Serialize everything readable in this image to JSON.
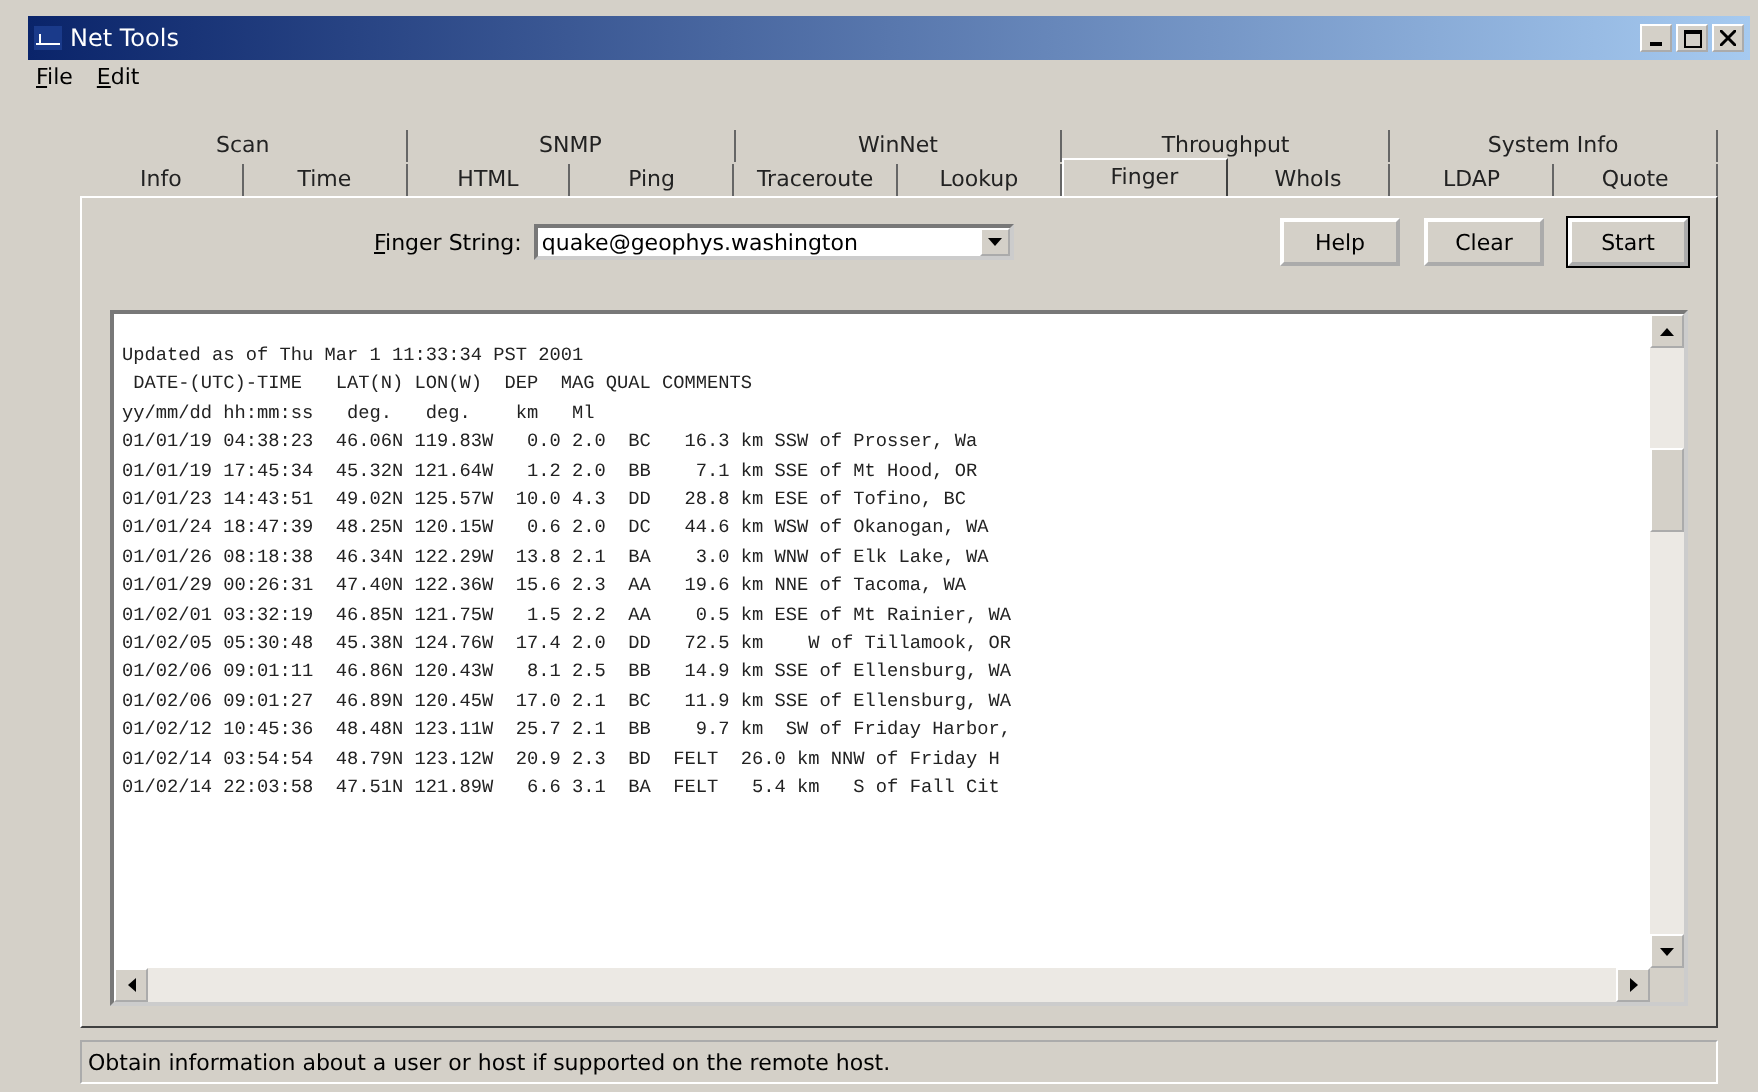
{
  "window": {
    "title": "Net Tools"
  },
  "menu": [
    "File",
    "Edit"
  ],
  "tab_rows": [
    [
      {
        "label": "Scan",
        "selected": false
      },
      {
        "label": "SNMP",
        "selected": false
      },
      {
        "label": "WinNet",
        "selected": false
      },
      {
        "label": "Throughput",
        "selected": false
      },
      {
        "label": "System Info",
        "selected": false
      }
    ],
    [
      {
        "label": "Info",
        "selected": false
      },
      {
        "label": "Time",
        "selected": false
      },
      {
        "label": "HTML",
        "selected": false
      },
      {
        "label": "Ping",
        "selected": false
      },
      {
        "label": "Traceroute",
        "selected": false
      },
      {
        "label": "Lookup",
        "selected": false
      },
      {
        "label": "Finger",
        "selected": true
      },
      {
        "label": "WhoIs",
        "selected": false
      },
      {
        "label": "LDAP",
        "selected": false
      },
      {
        "label": "Quote",
        "selected": false
      }
    ]
  ],
  "finger_string": {
    "label": "Finger String:",
    "value": "quake@geophys.washington"
  },
  "buttons": [
    {
      "label": "Help",
      "default": false
    },
    {
      "label": "Clear",
      "default": false
    },
    {
      "label": "Start",
      "default": true
    }
  ],
  "output_lines": [
    "Updated as of Thu Mar 1 11:33:34 PST 2001",
    " DATE-(UTC)-TIME   LAT(N) LON(W)  DEP  MAG QUAL COMMENTS",
    "yy/mm/dd hh:mm:ss   deg.   deg.    km   Ml",
    "01/01/19 04:38:23  46.06N 119.83W   0.0 2.0  BC   16.3 km SSW of Prosser, Wa",
    "01/01/19 17:45:34  45.32N 121.64W   1.2 2.0  BB    7.1 km SSE of Mt Hood, OR",
    "01/01/23 14:43:51  49.02N 125.57W  10.0 4.3  DD   28.8 km ESE of Tofino, BC",
    "01/01/24 18:47:39  48.25N 120.15W   0.6 2.0  DC   44.6 km WSW of Okanogan, WA",
    "01/01/26 08:18:38  46.34N 122.29W  13.8 2.1  BA    3.0 km WNW of Elk Lake, WA",
    "01/01/29 00:26:31  47.40N 122.36W  15.6 2.3  AA   19.6 km NNE of Tacoma, WA",
    "01/02/01 03:32:19  46.85N 121.75W   1.5 2.2  AA    0.5 km ESE of Mt Rainier, WA",
    "01/02/05 05:30:48  45.38N 124.76W  17.4 2.0  DD   72.5 km    W of Tillamook, OR",
    "01/02/06 09:01:11  46.86N 120.43W   8.1 2.5  BB   14.9 km SSE of Ellensburg, WA",
    "01/02/06 09:01:27  46.89N 120.45W  17.0 2.1  BC   11.9 km SSE of Ellensburg, WA",
    "01/02/12 10:45:36  48.48N 123.11W  25.7 2.1  BB    9.7 km  SW of Friday Harbor,",
    "01/02/14 03:54:54  48.79N 123.12W  20.9 2.3  BD  FELT  26.0 km NNW of Friday H",
    "01/02/14 22:03:58  47.51N 121.89W   6.6 3.1  BA  FELT   5.4 km   S of Fall Cit"
  ],
  "status_bar": "Obtain information about a user or host if supported on the remote host."
}
